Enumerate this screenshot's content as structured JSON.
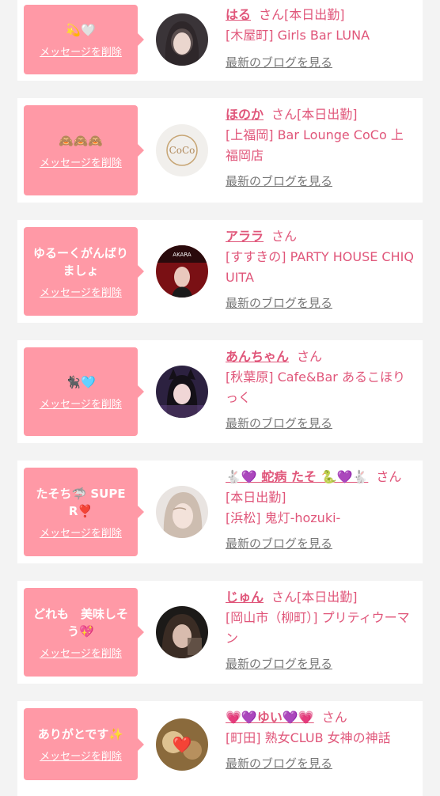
{
  "delete_label": "メッセージを削除",
  "suffix": "さん",
  "blog_label": "最新のブログを見る",
  "colors": {
    "accent": "#e0567a",
    "bubble": "#ff99a6",
    "link_gray": "#777777"
  },
  "cards": [
    {
      "message": "💫🤍",
      "name": "はる",
      "status": "[本日出勤]",
      "shop": "[木屋町] Girls Bar LUNA"
    },
    {
      "message": "🙈🙈🙈",
      "name": "ほのか",
      "status": "[本日出勤]",
      "shop": "[上福岡] Bar Lounge CoCo 上福岡店",
      "avatar_text": "CoCo"
    },
    {
      "message": "ゆるーくがんばりましょ",
      "name": "アララ",
      "status": "",
      "shop": "[すすきの] PARTY HOUSE CHIQUITA",
      "avatar_text": "AKARA"
    },
    {
      "message": "🐈‍⬛🩵",
      "name": "あんちゃん",
      "status": "",
      "shop": "[秋葉原] Cafe&Bar あるこほりっく"
    },
    {
      "message": "たそち🦈 SUPER❣️",
      "name": "🐇💜 蛇病 たそ 🐍💜🐇",
      "status": "[本日出勤]",
      "shop": "[浜松] 鬼灯-hozuki-"
    },
    {
      "message": "どれも　美味しそう💖",
      "name": "じゅん",
      "status": "[本日出勤]",
      "shop": "[岡山市（柳町）] プリティウーマン"
    },
    {
      "message": "ありがとです✨",
      "name": "💗💜ゆい💜💗",
      "status": "",
      "shop": "[町田] 熟女CLUB 女神の神話",
      "avatar_text": "❤️"
    }
  ]
}
